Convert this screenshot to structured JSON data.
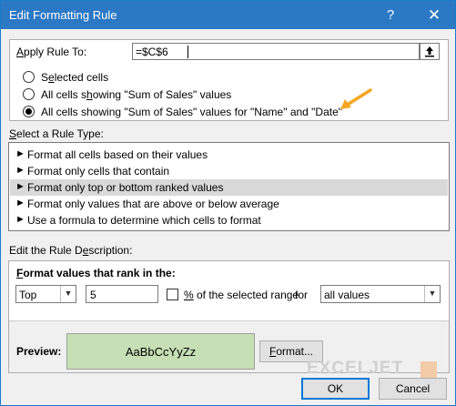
{
  "window": {
    "title": "Edit Formatting Rule",
    "help_glyph": "?",
    "close_glyph": "✕"
  },
  "apply": {
    "label_letter": "A",
    "label_rest": "pply Rule To:",
    "value": "=$C$6",
    "options": [
      {
        "pre": "S",
        "u": "e",
        "post": "lected cells",
        "selected": false
      },
      {
        "pre": "All cells s",
        "u": "h",
        "post": "owing \"Sum of Sales\" values",
        "selected": false
      },
      {
        "pre": "All cells showing \"Sum of Sales\" values for \"Name\" and \"Date\"",
        "u": "",
        "post": "",
        "selected": true
      }
    ]
  },
  "rule_type": {
    "heading_letter": "S",
    "heading_rest": "elect a Rule Type:",
    "items": [
      {
        "label": "Format all cells based on their values",
        "selected": false
      },
      {
        "label": "Format only cells that contain",
        "selected": false
      },
      {
        "label": "Format only top or bottom ranked values",
        "selected": true
      },
      {
        "label": "Format only values that are above or below average",
        "selected": false
      },
      {
        "label": "Use a formula to determine which cells to format",
        "selected": false
      }
    ],
    "arrow_glyph": "►"
  },
  "description": {
    "heading_pre": "Edit the Rule D",
    "heading_u": "e",
    "heading_post": "scription:",
    "rank_label_pre": "F",
    "rank_label_post": "ormat values that rank in the:",
    "top_bottom_value": "Top",
    "count_value": "5",
    "percent_label_pre": "",
    "percent_label_u": "%",
    "percent_label_post": " of the selected range",
    "for_label": "for",
    "scope_value": "all values",
    "preview_label": "Preview:",
    "preview_sample": "AaBbCcYyZz",
    "format_button_pre": "",
    "format_button_u": "F",
    "format_button_post": "ormat..."
  },
  "buttons": {
    "ok": "OK",
    "cancel": "Cancel"
  },
  "watermark": "EXCELJET",
  "colors": {
    "titlebar": "#2b79c5",
    "preview_fill": "#c6dfb4",
    "annotation_arrow": "#f5a623"
  }
}
